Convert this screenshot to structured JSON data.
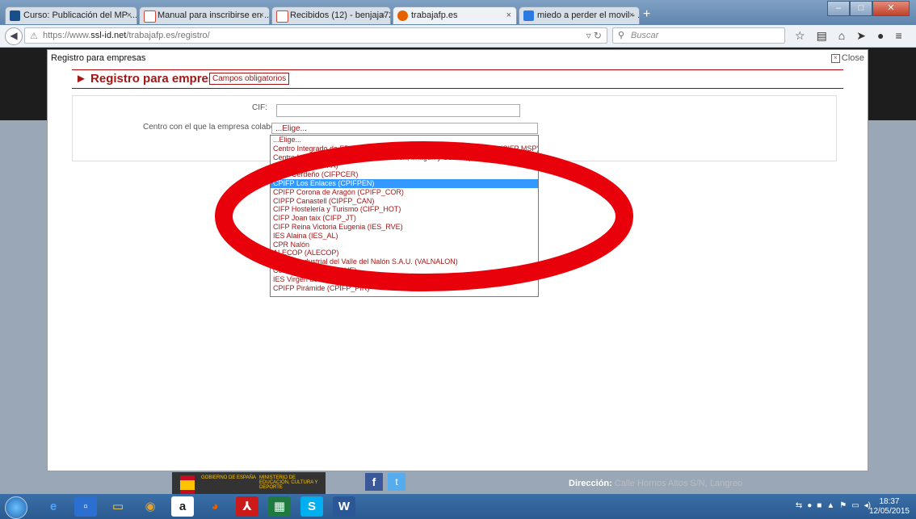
{
  "browser": {
    "tabs": [
      {
        "label": "Curso: Publicación del MP ...",
        "favicon": "course-favicon",
        "color": "#1a4e8a"
      },
      {
        "label": "Manual para inscribirse en ...",
        "favicon": "gmail-favicon",
        "color": "#d14836"
      },
      {
        "label": "Recibidos (12) - benjaja72...",
        "favicon": "gmail-favicon",
        "color": "#d14836"
      },
      {
        "label": "trabajafp.es",
        "favicon": "firefox-favicon",
        "color": "#e66000"
      },
      {
        "label": "miedo a perder el movil - ...",
        "favicon": "bing-favicon",
        "color": "#2a7ae2"
      }
    ],
    "url_prefix": "https://www.",
    "url_domain": "ssl-id.net",
    "url_path": "/trabajafp.es/registro/",
    "search_placeholder": "Buscar",
    "close_symbol": "×",
    "new_tab_symbol": "+"
  },
  "modal": {
    "title": "Registro para empresas",
    "close_label": "Close",
    "header_title": "Registro para empresas",
    "required_note": "Campos obligatorios",
    "cif_label": "CIF:",
    "centro_label": "Centro con el que la empresa colabora",
    "select_value": "...Elige...",
    "options": [
      "...Elige...",
      "Centro Integrado de FP de Mantenimiento y Servicios a la Producción (CIFP MSP)",
      "Centro Integrado de FP de Comunicación, Imagen y Sonido (CISLAN)",
      "CIFP Avilés (CIFPA)",
      "CIFP Cerdeño (CIFPCER)",
      "CPIFP Los Enlaces (CPIFPEN)",
      "CPIFP Corona de Aragón (CPIFP_COR)",
      "CIPFP Canastell (CIPFP_CAN)",
      "CIFP Hostelería y Turismo (CIFP_HOT)",
      "CIFP Joan taix (CIFP_JT)",
      "CIFP Reina Victoria Eugenia (IES_RVE)",
      "IES Alaina (IES_AL)",
      "CPR Nalón",
      "ALECOP (ALECOP)",
      "Ciudad Industrial del Valle del Nalón S.A.U. (VALNALON)",
      "Centro de prueba (PRUE)",
      "IES Virgen de la Paloma (IESVP)",
      "CPIFP Pirámide (CPIFP_PIR)"
    ],
    "selected_index": 5
  },
  "footer": {
    "gov_text": "GOBIERNO DE ESPAÑA",
    "ministry_text": "MINISTERIO DE EDUCACIÓN, CULTURA Y DEPORTE",
    "address_label": "Dirección:",
    "address_value": "Calle Hornos Altos S/N, Langreo"
  },
  "taskbar": {
    "time": "18:37",
    "date": "12/05/2015"
  },
  "annotation_color": "#e8000b"
}
